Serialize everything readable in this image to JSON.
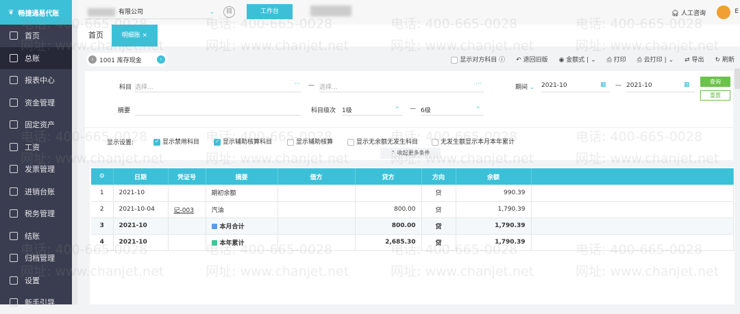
{
  "app": {
    "brand": "畅捷通易代账",
    "company_suffix": "有限公司",
    "workbench": "工作台",
    "support": "人工咨询",
    "user_initial": "E"
  },
  "sidebar": {
    "items": [
      {
        "label": "首页"
      },
      {
        "label": "总账"
      },
      {
        "label": "报表中心"
      },
      {
        "label": "资金管理"
      },
      {
        "label": "固定资产"
      },
      {
        "label": "工资"
      },
      {
        "label": "发票管理"
      },
      {
        "label": "进销台账"
      },
      {
        "label": "税务管理"
      },
      {
        "label": "结账"
      },
      {
        "label": "归档管理"
      },
      {
        "label": "设置"
      },
      {
        "label": "新手引导"
      }
    ],
    "active": 1
  },
  "tabs": [
    {
      "label": "首页"
    },
    {
      "label": "明细账",
      "close": "×"
    }
  ],
  "toolbar": {
    "account": "1001 库存现金",
    "show_opposite": "显示对方科目",
    "back_old": "退回旧版",
    "amount_format": "金额式",
    "print": "打印",
    "cloud_print": "云打印",
    "export": "导出",
    "refresh": "刷新"
  },
  "filter": {
    "subject_label": "科目",
    "subject_placeholder": "选择...",
    "dash": "—",
    "period_label": "期间",
    "period_from": "2021-10",
    "period_to": "2021-10",
    "summary_label": "摘要",
    "level_label": "科目级次",
    "level_from": "1级",
    "level_to": "6级",
    "query": "查询",
    "reset": "重置",
    "display_label": "显示设置:",
    "options": [
      {
        "label": "显示禁用科目",
        "checked": true
      },
      {
        "label": "显示辅助核算科目",
        "checked": true
      },
      {
        "label": "显示辅助核算",
        "checked": false
      },
      {
        "label": "显示无余额无发生科目",
        "checked": false
      },
      {
        "label": "无发生额显示本月本年累计",
        "checked": false
      }
    ],
    "collapse": "收起更多条件"
  },
  "table": {
    "headers": [
      "日期",
      "凭证号",
      "摘要",
      "借方",
      "贷方",
      "方向",
      "余额"
    ],
    "rows": [
      {
        "no": "1",
        "date": "2021-10",
        "voucher": "",
        "summary": "期初余额",
        "debit": "",
        "credit": "",
        "dir": "贷",
        "balance": "990.39"
      },
      {
        "no": "2",
        "date": "2021-10-04",
        "voucher": "记-003",
        "summary": "汽油",
        "debit": "",
        "credit": "800.00",
        "dir": "贷",
        "balance": "1,790.39"
      },
      {
        "no": "3",
        "date": "2021-10",
        "voucher": "",
        "summary": "本月合计",
        "debit": "",
        "credit": "800.00",
        "dir": "贷",
        "balance": "1,790.39"
      },
      {
        "no": "4",
        "date": "2021-10",
        "voucher": "",
        "summary": "本年累计",
        "debit": "",
        "credit": "2,685.30",
        "dir": "贷",
        "balance": "1,790.39"
      }
    ]
  },
  "watermark": {
    "phone": "电话: 400-665-0028",
    "site": "网址: www.chanjet.net"
  },
  "colors": {
    "accent": "#3cc0d8",
    "sidebar": "#3a3d4f",
    "query": "#6cc24a",
    "month_total": "#5b9cf0",
    "year_total": "#3cc89a"
  }
}
